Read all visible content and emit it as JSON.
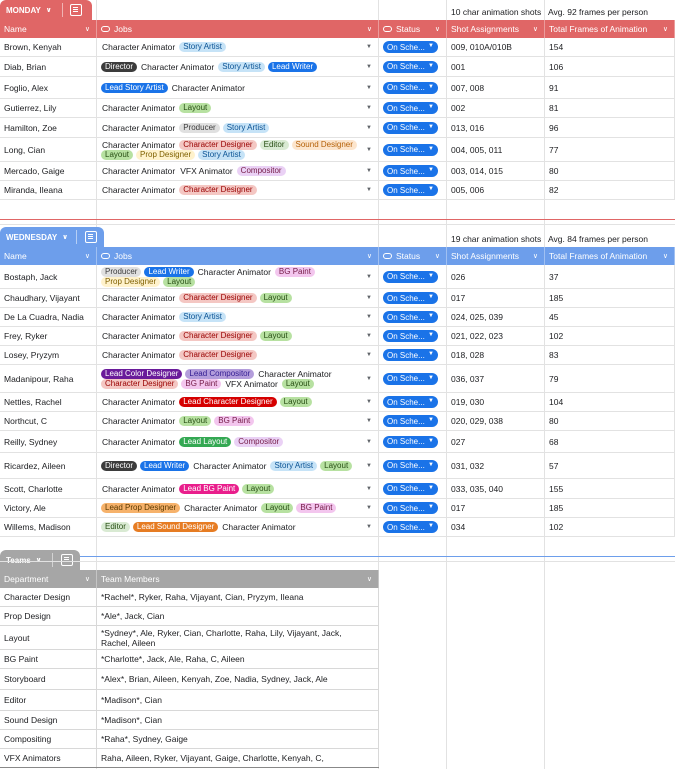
{
  "colors": {
    "monday": "#e06666",
    "wednesday": "#6d9eeb",
    "teams": "#a6a6a6",
    "status": "#1a73e8"
  },
  "chip_colors": {
    "Story Artist": [
      "#c6e3f7",
      "#0b5394"
    ],
    "Director": [
      "#3c3c3c",
      "#ffffff"
    ],
    "Lead Writer": [
      "#1a73e8",
      "#ffffff"
    ],
    "Lead Story Artist": [
      "#1a73e8",
      "#ffffff"
    ],
    "Layout": [
      "#b7e1a1",
      "#274e13"
    ],
    "Producer": [
      "#e0e0e0",
      "#3c3c3c"
    ],
    "Character Designer": [
      "#f4c7c3",
      "#990000"
    ],
    "Editor": [
      "#d9ead3",
      "#274e13"
    ],
    "Sound Designer": [
      "#fce5cd",
      "#b45f06"
    ],
    "Prop Designer": [
      "#fff2cc",
      "#7f6000"
    ],
    "Compositor": [
      "#ead1f5",
      "#741b47"
    ],
    "BG Paint": [
      "#f3c6ee",
      "#741b47"
    ],
    "Lead Color Designer": [
      "#6a1b9a",
      "#ffffff"
    ],
    "Lead Compositor": [
      "#b39ddb",
      "#311b92"
    ],
    "Lead Character Designer": [
      "#d50000",
      "#ffffff"
    ],
    "Lead Layout": [
      "#34a853",
      "#ffffff"
    ],
    "Lead BG Paint": [
      "#e91e8c",
      "#ffffff"
    ],
    "Lead Prop Designer": [
      "#f6b26b",
      "#5b3a00"
    ],
    "Lead Sound Designer": [
      "#e67c23",
      "#ffffff"
    ]
  },
  "plain_jobs": [
    "Character Animator",
    "VFX Animator"
  ],
  "monday": {
    "tab_label": "MONDAY",
    "hint1": "10 char animation shots",
    "hint2": "Avg. 92 frames per person",
    "headers": [
      "Name",
      "Jobs",
      "Status",
      "Shot Assignments",
      "Total Frames of Animation"
    ],
    "rows": [
      {
        "name": "Brown, Kenyah",
        "jobs": [
          "Character Animator",
          "Story Artist"
        ],
        "status": "On Sche...",
        "shots": "009, 010A/010B",
        "frames": "154",
        "h": 19
      },
      {
        "name": "Diab, Brian",
        "jobs": [
          "Director",
          "Character Animator",
          "Story Artist",
          "Lead Writer"
        ],
        "status": "On Sche...",
        "shots": "001",
        "frames": "106",
        "h": 20
      },
      {
        "name": "Foglio, Alex",
        "jobs": [
          "Lead Story Artist",
          "Character Animator"
        ],
        "status": "On Sche...",
        "shots": "007, 008",
        "frames": "91",
        "h": 22
      },
      {
        "name": "Gutierrez, Lily",
        "jobs": [
          "Character Animator",
          "Layout"
        ],
        "status": "On Sche...",
        "shots": "002",
        "frames": "81",
        "h": 19
      },
      {
        "name": "Hamilton, Zoe",
        "jobs": [
          "Character Animator",
          "Producer",
          "Story Artist"
        ],
        "status": "On Sche...",
        "shots": "013, 016",
        "frames": "96",
        "h": 20
      },
      {
        "name": "Long, Cian",
        "jobs": [
          "Character Animator",
          "Character Designer",
          "Editor",
          "Sound Designer",
          "Layout",
          "Prop Designer",
          "Story Artist"
        ],
        "status": "On Sche...",
        "shots": "004, 005, 011",
        "frames": "77",
        "h": 24
      },
      {
        "name": "Mercado, Gaige",
        "jobs": [
          "Character Animator",
          "VFX Animator",
          "Compositor"
        ],
        "status": "On Sche...",
        "shots": "003, 014, 015",
        "frames": "80",
        "h": 19
      },
      {
        "name": "Miranda, Ileana",
        "jobs": [
          "Character Animator",
          "Character Designer"
        ],
        "status": "On Sche...",
        "shots": "005, 006",
        "frames": "82",
        "h": 19
      }
    ]
  },
  "wednesday": {
    "tab_label": "WEDNESDAY",
    "hint1": "19 char animation shots",
    "hint2": "Avg. 84 frames per person",
    "headers": [
      "Name",
      "Jobs",
      "Status",
      "Shot Assignments",
      "Total Frames of Animation"
    ],
    "rows": [
      {
        "name": "Bostaph, Jack",
        "jobs": [
          "Producer",
          "Lead Writer",
          "Character Animator",
          "BG Paint",
          "Prop Designer",
          "Layout"
        ],
        "status": "On Sche...",
        "shots": "026",
        "frames": "37",
        "h": 24
      },
      {
        "name": "Chaudhary, Vijayant",
        "jobs": [
          "Character Animator",
          "Character Designer",
          "Layout"
        ],
        "status": "On Sche...",
        "shots": "017",
        "frames": "185",
        "h": 19
      },
      {
        "name": "De La Cuadra, Nadia",
        "jobs": [
          "Character Animator",
          "Story Artist"
        ],
        "status": "On Sche...",
        "shots": "024, 025, 039",
        "frames": "45",
        "h": 19
      },
      {
        "name": "Frey, Ryker",
        "jobs": [
          "Character Animator",
          "Character Designer",
          "Layout"
        ],
        "status": "On Sche...",
        "shots": "021, 022, 023",
        "frames": "102",
        "h": 19
      },
      {
        "name": "Losey, Pryzym",
        "jobs": [
          "Character Animator",
          "Character Designer"
        ],
        "status": "On Sche...",
        "shots": "018, 028",
        "frames": "83",
        "h": 19
      },
      {
        "name": "Madanipour, Raha",
        "jobs": [
          "Lead Color Designer",
          "Lead Compositor",
          "Character Animator",
          "Character Designer",
          "BG Paint",
          "VFX Animator",
          "Layout"
        ],
        "status": "On Sche...",
        "shots": "036, 037",
        "frames": "79",
        "h": 28
      },
      {
        "name": "Nettles, Rachel",
        "jobs": [
          "Character Animator",
          "Lead Character Designer",
          "Layout"
        ],
        "status": "On Sche...",
        "shots": "019, 030",
        "frames": "104",
        "h": 19
      },
      {
        "name": "Northcut, C",
        "jobs": [
          "Character Animator",
          "Layout",
          "BG Paint"
        ],
        "status": "On Sche...",
        "shots": "020, 029, 038",
        "frames": "80",
        "h": 19
      },
      {
        "name": "Reilly, Sydney",
        "jobs": [
          "Character Animator",
          "Lead Layout",
          "Compositor"
        ],
        "status": "On Sche...",
        "shots": "027",
        "frames": "68",
        "h": 22
      },
      {
        "name": "Ricardez, Aileen",
        "jobs": [
          "Director",
          "Lead Writer",
          "Character Animator",
          "Story Artist",
          "Layout"
        ],
        "status": "On Sche...",
        "shots": "031, 032",
        "frames": "57",
        "h": 26
      },
      {
        "name": "Scott, Charlotte",
        "jobs": [
          "Character Animator",
          "Lead BG Paint",
          "Layout"
        ],
        "status": "On Sche...",
        "shots": "033, 035, 040",
        "frames": "155",
        "h": 20
      },
      {
        "name": "Victory, Ale",
        "jobs": [
          "Lead Prop Designer",
          "Character Animator",
          "Layout",
          "BG Paint"
        ],
        "status": "On Sche...",
        "shots": "017",
        "frames": "185",
        "h": 19
      },
      {
        "name": "Willems, Madison",
        "jobs": [
          "Editor",
          "Lead Sound Designer",
          "Character Animator"
        ],
        "status": "On Sche...",
        "shots": "034",
        "frames": "102",
        "h": 19
      }
    ]
  },
  "teams": {
    "tab_label": "Teams",
    "headers": [
      "Department",
      "Team Members"
    ],
    "rows": [
      {
        "dept": "Character Design",
        "members": "*Rachel*, Ryker, Raha, Vijayant, Cian, Pryzym, Ileana",
        "h": 19
      },
      {
        "dept": "Prop Design",
        "members": "*Ale*, Jack, Cian",
        "h": 19
      },
      {
        "dept": "Layout",
        "members": "*Sydney*, Ale, Ryker, Cian, Charlotte, Raha, Lily, Vijayant, Jack, Rachel, Aileen",
        "h": 24
      },
      {
        "dept": "BG Paint",
        "members": "*Charlotte*, Jack, Ale, Raha, C, Aileen",
        "h": 19
      },
      {
        "dept": "Storyboard",
        "members": "*Alex*, Brian, Aileen, Kenyah, Zoe, Nadia, Sydney, Jack, Ale",
        "h": 21
      },
      {
        "dept": "Editor",
        "members": "*Madison*, Cian",
        "h": 21
      },
      {
        "dept": "Sound Design",
        "members": "*Madison*, Cian",
        "h": 19
      },
      {
        "dept": "Compositing",
        "members": "*Raha*, Sydney, Gaige",
        "h": 19
      },
      {
        "dept": "VFX Animators",
        "members": "Raha, Aileen, Ryker, Vijayant, Gaige, Charlotte, Kenyah, C,",
        "h": 19
      }
    ]
  }
}
